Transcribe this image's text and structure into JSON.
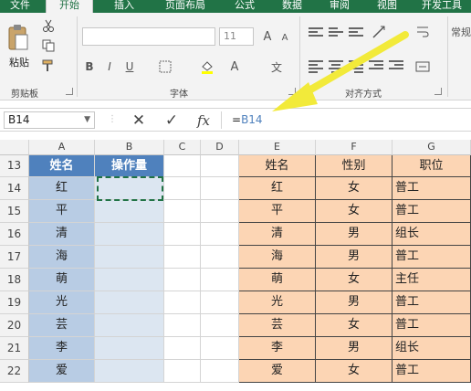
{
  "ribbon_tabs": [
    "文件",
    "开始",
    "插入",
    "页面布局",
    "公式",
    "数据",
    "审阅",
    "视图",
    "开发工具"
  ],
  "active_tab": "开始",
  "ribbon": {
    "paste_label": "粘贴",
    "clipboard_group": "剪贴板",
    "font_group": "字体",
    "align_group": "对齐方式",
    "font_size": "11",
    "number_format": "常规"
  },
  "formula_bar": {
    "name_box": "B14",
    "cancel_icon": "✕",
    "enter_icon": "✓",
    "fx_label": "fx",
    "formula": "=B14"
  },
  "columns": [
    "A",
    "B",
    "C",
    "D",
    "E",
    "F",
    "G"
  ],
  "rows": [
    "13",
    "14",
    "15",
    "16",
    "17",
    "18",
    "19",
    "20",
    "21",
    "22"
  ],
  "left_table": {
    "headers": [
      "姓名",
      "操作量"
    ],
    "names": [
      "红",
      "平",
      "清",
      "海",
      "萌",
      "光",
      "芸",
      "李",
      "爱"
    ]
  },
  "right_table": {
    "headers": [
      "姓名",
      "性别",
      "职位"
    ],
    "rows": [
      [
        "红",
        "女",
        "普工"
      ],
      [
        "平",
        "女",
        "普工"
      ],
      [
        "清",
        "男",
        "组长"
      ],
      [
        "海",
        "男",
        "普工"
      ],
      [
        "萌",
        "女",
        "主任"
      ],
      [
        "光",
        "男",
        "普工"
      ],
      [
        "芸",
        "女",
        "普工"
      ],
      [
        "李",
        "男",
        "组长"
      ],
      [
        "爱",
        "女",
        "普工"
      ]
    ]
  },
  "colors": {
    "excel_green": "#217346",
    "header_blue": "#4f81bd",
    "peach": "#fcd5b4",
    "arrow": "#f2ea3a"
  }
}
